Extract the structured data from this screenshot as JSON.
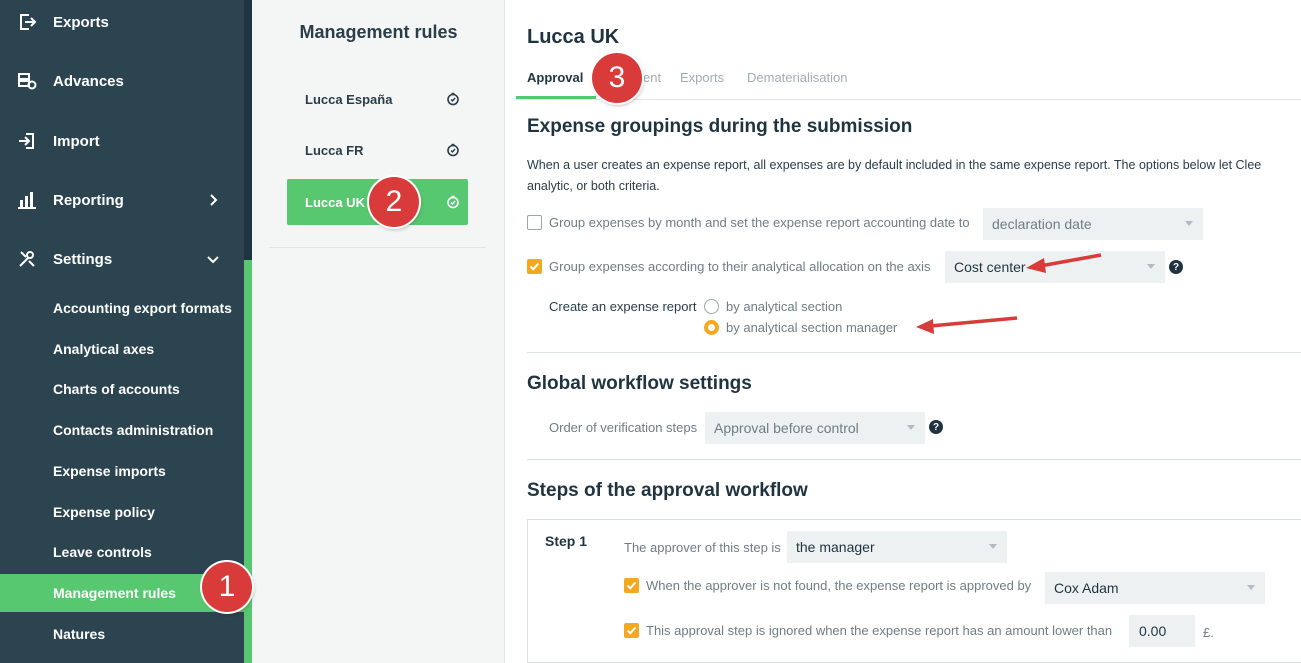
{
  "sidebar": {
    "items": [
      {
        "label": "Exports",
        "icon": "export-icon"
      },
      {
        "label": "Advances",
        "icon": "advances-icon"
      },
      {
        "label": "Import",
        "icon": "import-icon"
      },
      {
        "label": "Reporting",
        "icon": "bar-chart-icon"
      },
      {
        "label": "Settings",
        "icon": "tools-icon"
      }
    ],
    "sub_items": [
      {
        "label": "Accounting export formats"
      },
      {
        "label": "Analytical axes"
      },
      {
        "label": "Charts of accounts"
      },
      {
        "label": "Contacts administration"
      },
      {
        "label": "Expense imports"
      },
      {
        "label": "Expense policy"
      },
      {
        "label": "Leave controls"
      },
      {
        "label": "Management rules"
      },
      {
        "label": "Natures"
      }
    ]
  },
  "middle": {
    "title": "Management rules",
    "rules": [
      {
        "label": "Lucca España"
      },
      {
        "label": "Lucca FR"
      },
      {
        "label": "Lucca UK"
      }
    ]
  },
  "main": {
    "title": "Lucca UK",
    "tabs": [
      {
        "label": "Approval"
      },
      {
        "label": "ent"
      },
      {
        "label": "Exports"
      },
      {
        "label": "Dematerialisation"
      }
    ],
    "groupings": {
      "heading": "Expense groupings during the submission",
      "desc_line1": "When a user creates an expense report, all expenses are by default included in the same expense report. The options below let Clee",
      "desc_line2": "analytic, or both criteria.",
      "by_month_label": "Group expenses by month and set the expense report accounting date to",
      "by_month_checked": false,
      "date_select": "declaration date",
      "by_axis_label": "Group expenses according to their analytical allocation on the axis",
      "by_axis_checked": true,
      "axis_select": "Cost center",
      "create_label": "Create an expense report",
      "radio_section": "by analytical section",
      "radio_manager": "by analytical section manager",
      "radio_selected": "by analytical section manager"
    },
    "workflow": {
      "heading": "Global workflow settings",
      "order_label": "Order of verification steps",
      "order_select": "Approval before control"
    },
    "steps": {
      "heading": "Steps of the approval workflow",
      "step_label": "Step 1",
      "approver_label": "The approver of this step is",
      "approver_select": "the manager",
      "not_found_label": "When the approver is not found, the expense report is approved by",
      "not_found_checked": true,
      "fallback_select": "Cox Adam",
      "ignored_label": "This approval step is ignored when the expense report has an amount lower than",
      "ignored_checked": true,
      "amount_value": "0.00",
      "currency": "£."
    },
    "help_glyph": "?"
  },
  "annotations": {
    "badge1": "1",
    "badge2": "2",
    "badge3": "3"
  },
  "colors": {
    "sidebar_bg": "#2b4450",
    "accent_green": "#58c870",
    "checkbox_orange": "#f3a81f",
    "badge_red": "#d93a3a",
    "arrow_red": "#d93a3a"
  }
}
